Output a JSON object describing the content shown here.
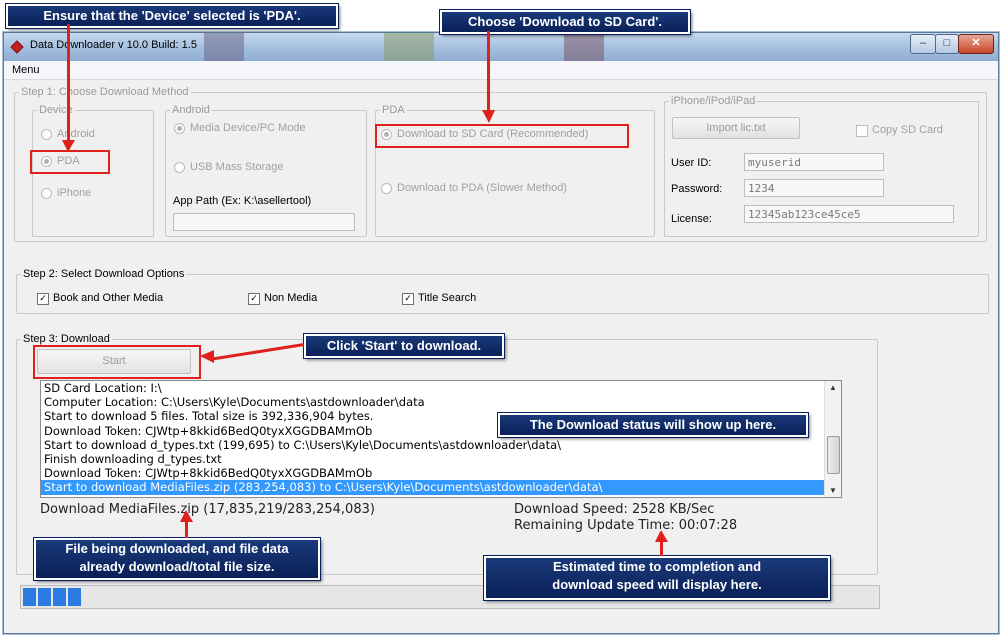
{
  "window": {
    "title": "Data Downloader v 10.0 Build: 1.5",
    "controls": {
      "minimize": "–",
      "maximize": "□",
      "close": "✕"
    },
    "menu": "Menu"
  },
  "step1": {
    "legend": "Step 1: Choose Download Method",
    "device": {
      "legend": "Device",
      "options": [
        "Android",
        "PDA",
        "iPhone"
      ],
      "selected": "PDA"
    },
    "android": {
      "legend": "Android",
      "options": [
        "Media Device/PC Mode",
        "USB Mass Storage"
      ],
      "app_path_label": "App Path (Ex: K:\\asellertool)",
      "app_path_value": ""
    },
    "pda": {
      "legend": "PDA",
      "options": [
        "Download to SD Card (Recommended)",
        "Download to PDA (Slower Method)"
      ]
    },
    "iphone": {
      "legend": "iPhone/iPod/iPad",
      "import_button": "Import lic.txt",
      "copy_sd_label": "Copy SD Card",
      "user_id_label": "User ID:",
      "user_id_value": "myuserid",
      "password_label": "Password:",
      "password_value": "1234",
      "license_label": "License:",
      "license_value": "12345ab123ce45ce5"
    }
  },
  "step2": {
    "legend": "Step 2: Select Download Options",
    "options": [
      {
        "label": "Book and Other Media",
        "checked": true
      },
      {
        "label": "Non Media",
        "checked": true
      },
      {
        "label": "Title Search",
        "checked": true
      }
    ]
  },
  "step3": {
    "legend": "Step 3: Download",
    "start_button": "Start",
    "log": [
      "SD Card Location: I:\\",
      "Computer Location: C:\\Users\\Kyle\\Documents\\astdownloader\\data",
      "Start to download 5 files. Total size is 392,336,904 bytes.",
      "Download Token: CJWtp+8kkid6BedQ0tyxXGGDBAMmOb",
      "Start to download d_types.txt (199,695) to C:\\Users\\Kyle\\Documents\\astdownloader\\data\\",
      "Finish downloading d_types.txt",
      "Download Token: CJWtp+8kkid6BedQ0tyxXGGDBAMmOb",
      "Start to download MediaFiles.zip (283,254,083) to C:\\Users\\Kyle\\Documents\\astdownloader\\data\\"
    ],
    "current_file": "Download MediaFiles.zip (17,835,219/283,254,083)",
    "download_speed": "Download Speed: 2528 KB/Sec",
    "remaining_time": "Remaining Update Time: 00:07:28",
    "progress_blocks": 4
  },
  "annotations": {
    "device": "Ensure that the 'Device' selected is 'PDA'.",
    "sdcard": "Choose 'Download to SD Card'.",
    "start": "Click 'Start' to download.",
    "status": "The Download status will show up here.",
    "filedata": [
      "File being downloaded, and file data",
      "already download/total file size."
    ],
    "estimate": [
      "Estimated time to completion and",
      "download speed will display here."
    ]
  },
  "colors": {
    "annotation_bg": "#0a2058",
    "highlight_red": "#e0201a",
    "selection_blue": "#3399ff",
    "progress_blue": "#2b7be3"
  }
}
